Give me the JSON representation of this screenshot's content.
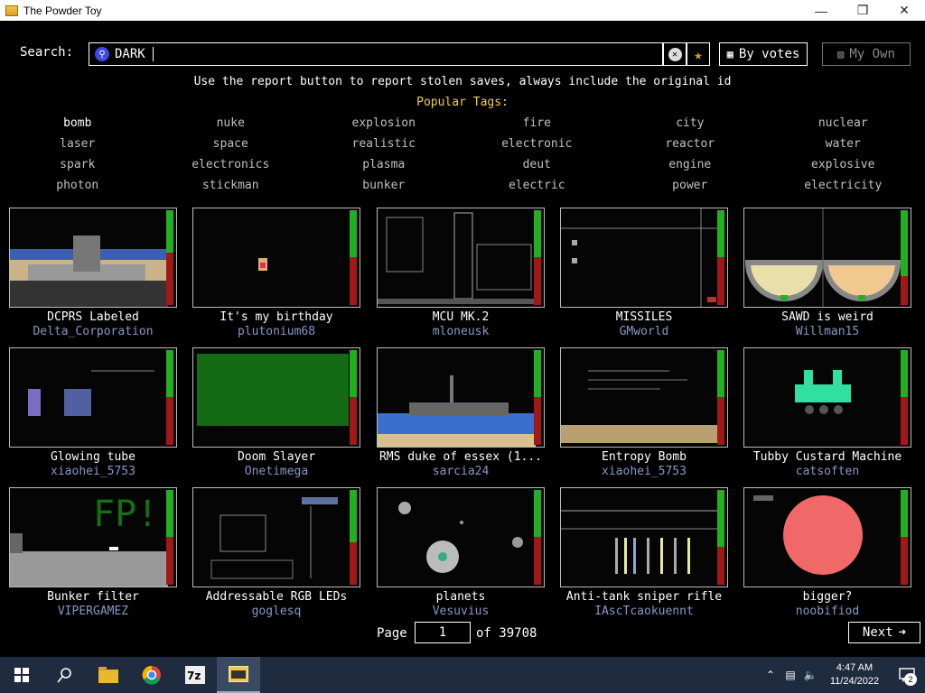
{
  "window": {
    "title": "The Powder Toy"
  },
  "search": {
    "label": "Search:",
    "query": "DARK",
    "sort_label": "By votes",
    "own_label": "My Own"
  },
  "notice": "Use the report button to report stolen saves, always include the original id",
  "popular_title": "Popular Tags:",
  "tags": [
    [
      "bomb",
      "nuke",
      "explosion",
      "fire",
      "city",
      "nuclear"
    ],
    [
      "laser",
      "space",
      "realistic",
      "electronic",
      "reactor",
      "water"
    ],
    [
      "spark",
      "electronics",
      "plasma",
      "deut",
      "engine",
      "explosive"
    ],
    [
      "photon",
      "stickman",
      "bunker",
      "electric",
      "power",
      "electricity"
    ]
  ],
  "saves": [
    {
      "name": "DCPRS Labeled",
      "author": "Delta_Corporation",
      "up": 0.45,
      "down": 0.55
    },
    {
      "name": "It's my birthday",
      "author": "plutonium68",
      "up": 0.5,
      "down": 0.5
    },
    {
      "name": "MCU MK.2",
      "author": "mloneusk",
      "up": 0.5,
      "down": 0.5
    },
    {
      "name": "MISSILES",
      "author": "GMworld",
      "up": 0.5,
      "down": 0.5
    },
    {
      "name": "SAWD is weird",
      "author": "Willman15",
      "up": 0.7,
      "down": 0.3
    },
    {
      "name": "Glowing tube",
      "author": "xiaohei_5753",
      "up": 0.5,
      "down": 0.5
    },
    {
      "name": "Doom Slayer",
      "author": "Onetimega",
      "up": 0.5,
      "down": 0.5
    },
    {
      "name": "RMS duke of essex (1...",
      "author": "sarcia24",
      "up": 0.5,
      "down": 0.5
    },
    {
      "name": "Entropy Bomb",
      "author": "xiaohei_5753",
      "up": 0.5,
      "down": 0.5
    },
    {
      "name": "Tubby Custard Machine",
      "author": "catsoften",
      "up": 0.5,
      "down": 0.5
    },
    {
      "name": "Bunker filter",
      "author": "VIPERGAMEZ",
      "up": 0.5,
      "down": 0.5
    },
    {
      "name": "Addressable RGB LEDs",
      "author": "goglesq",
      "up": 0.55,
      "down": 0.45
    },
    {
      "name": "planets",
      "author": "Vesuvius",
      "up": 0.5,
      "down": 0.5
    },
    {
      "name": "Anti-tank sniper rifle",
      "author": "IAscTcaokuennt",
      "up": 0.6,
      "down": 0.4
    },
    {
      "name": "bigger?",
      "author": "noobifiod",
      "up": 0.5,
      "down": 0.5
    }
  ],
  "pager": {
    "page_label": "Page",
    "page": "1",
    "of_label": "of 39708",
    "next_label": "Next"
  },
  "taskbar": {
    "time": "4:47 AM",
    "date": "11/24/2022",
    "notifications": "2"
  }
}
